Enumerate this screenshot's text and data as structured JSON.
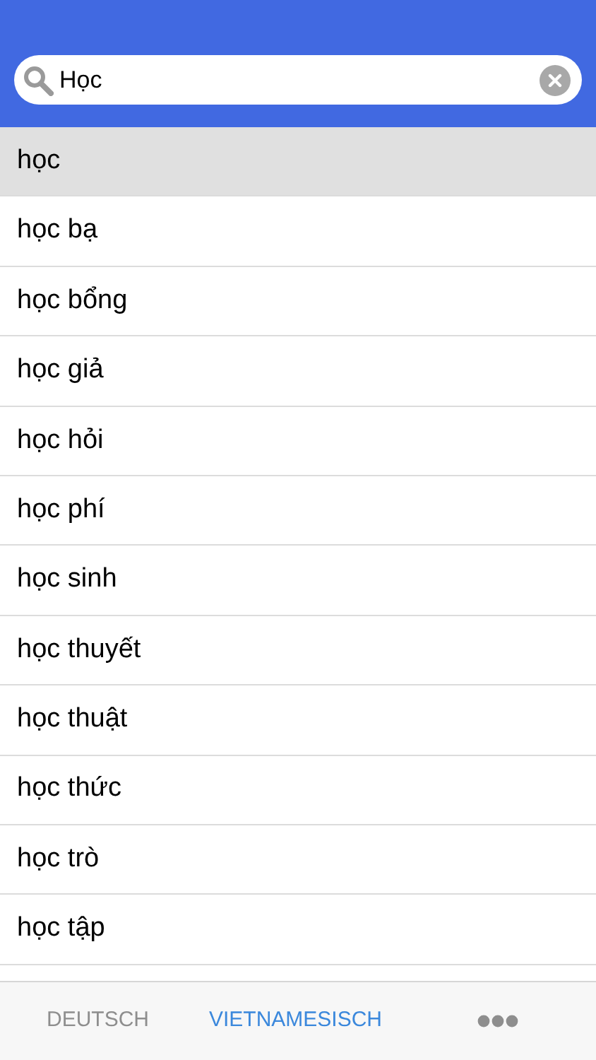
{
  "search": {
    "value": "Học"
  },
  "results": [
    {
      "label": "học",
      "selected": true
    },
    {
      "label": "học bạ",
      "selected": false
    },
    {
      "label": "học bổng",
      "selected": false
    },
    {
      "label": "học giả",
      "selected": false
    },
    {
      "label": "học hỏi",
      "selected": false
    },
    {
      "label": "học phí",
      "selected": false
    },
    {
      "label": "học sinh",
      "selected": false
    },
    {
      "label": "học thuyết",
      "selected": false
    },
    {
      "label": "học thuật",
      "selected": false
    },
    {
      "label": "học thức",
      "selected": false
    },
    {
      "label": "học trò",
      "selected": false
    },
    {
      "label": "học tập",
      "selected": false
    }
  ],
  "tabs": [
    {
      "kind": "text",
      "label": "DEUTSCH",
      "selected": false
    },
    {
      "kind": "text",
      "label": "VIETNAMESISCH",
      "selected": true
    },
    {
      "kind": "more",
      "selected": false
    }
  ]
}
